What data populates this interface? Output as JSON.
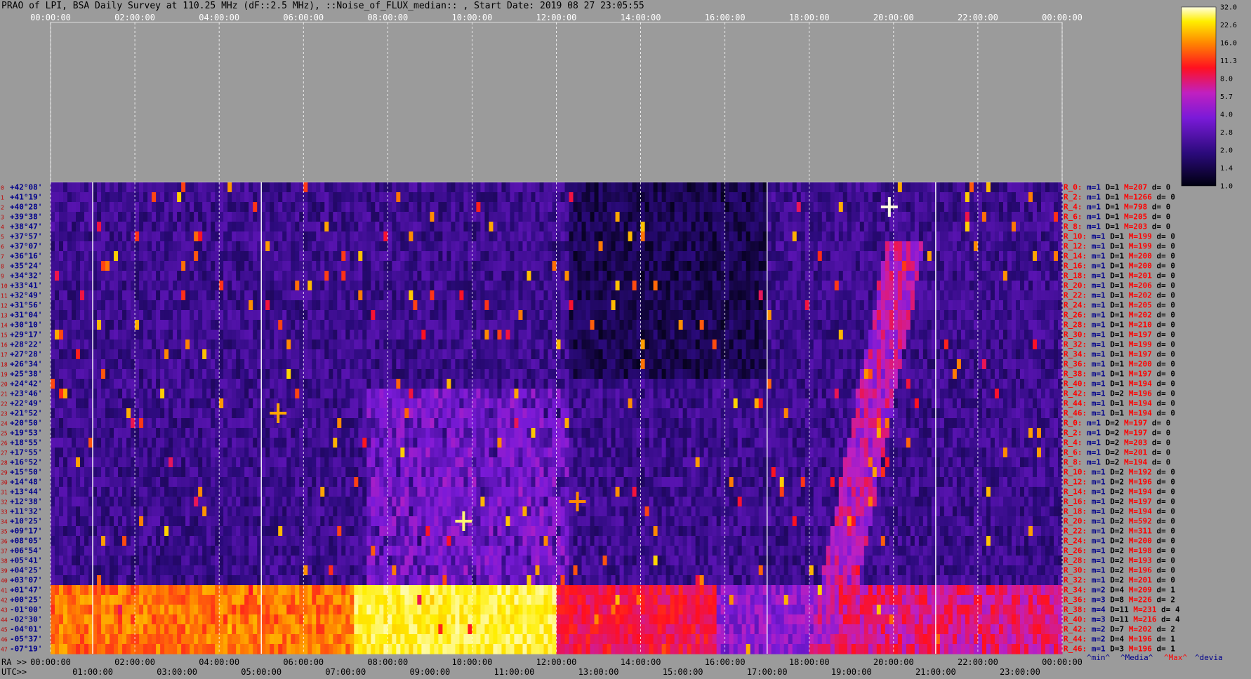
{
  "title": "PRAO of LPI, BSA Daily Survey at 110.25 MHz (dF::2.5 MHz), ::Noise_of_FLUX_median:: , Start Date: 2019 08 27 23:05:55",
  "colors": {
    "background": "#9b9b9b",
    "red_text": "#ff0000",
    "blue_text": "#00008b"
  },
  "axis": {
    "ra_label": "RA >>",
    "utc_label": "UTC>>",
    "top_ticks": [
      "00:00:00",
      "02:00:00",
      "04:00:00",
      "06:00:00",
      "08:00:00",
      "10:00:00",
      "12:00:00",
      "14:00:00",
      "16:00:00",
      "18:00:00",
      "20:00:00",
      "22:00:00",
      "00:00:00"
    ],
    "bottom_ra_ticks": [
      "00:00:00",
      "02:00:00",
      "04:00:00",
      "06:00:00",
      "08:00:00",
      "10:00:00",
      "12:00:00",
      "14:00:00",
      "16:00:00",
      "18:00:00",
      "20:00:00",
      "22:00:00",
      "00:00:00"
    ],
    "bottom_utc_ticks": [
      "01:00:00",
      "03:00:00",
      "05:00:00",
      "07:00:00",
      "09:00:00",
      "11:00:00",
      "13:00:00",
      "15:00:00",
      "17:00:00",
      "19:00:00",
      "21:00:00",
      "23:00:00"
    ]
  },
  "colorbar": {
    "labels": [
      "32.0",
      "22.6",
      "16.0",
      "11.3",
      "8.0",
      "5.7",
      "4.0",
      "2.8",
      "2.0",
      "1.4",
      "1.0"
    ]
  },
  "footer_legend": {
    "min": "^min^",
    "media": "^Media^",
    "max": "^Max^",
    "devia": "^devia"
  },
  "chart_data": {
    "type": "heatmap",
    "title": "PRAO of LPI, BSA Daily Survey at 110.25 MHz (dF::2.5 MHz), ::Noise_of_FLUX_median:: , Start Date: 2019 08 27 23:05:55",
    "xlabel": "RA / UTC",
    "x_range": [
      "00:00:00",
      "24:00:00"
    ],
    "colorbar_range": [
      1.0,
      32.0
    ],
    "declinations": [
      "+42°08'",
      "+41°19'",
      "+40°28'",
      "+39°38'",
      "+38°47'",
      "+37°57'",
      "+37°07'",
      "+36°16'",
      "+35°24'",
      "+34°32'",
      "+33°41'",
      "+32°49'",
      "+31°56'",
      "+31°04'",
      "+30°10'",
      "+29°17'",
      "+28°22'",
      "+27°28'",
      "+26°34'",
      "+25°38'",
      "+24°42'",
      "+23°46'",
      "+22°49'",
      "+21°52'",
      "+20°50'",
      "+19°53'",
      "+18°55'",
      "+17°55'",
      "+16°52'",
      "+15°50'",
      "+14°48'",
      "+13°44'",
      "+12°38'",
      "+11°32'",
      "+10°25'",
      "+09°17'",
      "+08°05'",
      "+06°54'",
      "+05°41'",
      "+04°25'",
      "+03°07'",
      "+01°47'",
      "+00°25'",
      "-01°00'",
      "-02°30'",
      "-04°01'",
      "-05°37'",
      "-07°19'"
    ],
    "row_stats": [
      {
        "r": "R_0:",
        "m": "m=1",
        "D": "D=1",
        "M": "M=207",
        "d": "d= 0"
      },
      {
        "r": "R_2:",
        "m": "m=1",
        "D": "D=1",
        "M": "M=1266",
        "d": "d= 0"
      },
      {
        "r": "R_4:",
        "m": "m=1",
        "D": "D=1",
        "M": "M=798",
        "d": "d= 0"
      },
      {
        "r": "R_6:",
        "m": "m=1",
        "D": "D=1",
        "M": "M=205",
        "d": "d= 0"
      },
      {
        "r": "R_8:",
        "m": "m=1",
        "D": "D=1",
        "M": "M=203",
        "d": "d= 0"
      },
      {
        "r": "R_10:",
        "m": "m=1",
        "D": "D=1",
        "M": "M=199",
        "d": "d= 0"
      },
      {
        "r": "R_12:",
        "m": "m=1",
        "D": "D=1",
        "M": "M=199",
        "d": "d= 0"
      },
      {
        "r": "R_14:",
        "m": "m=1",
        "D": "D=1",
        "M": "M=200",
        "d": "d= 0"
      },
      {
        "r": "R_16:",
        "m": "m=1",
        "D": "D=1",
        "M": "M=200",
        "d": "d= 0"
      },
      {
        "r": "R_18:",
        "m": "m=1",
        "D": "D=1",
        "M": "M=201",
        "d": "d= 0"
      },
      {
        "r": "R_20:",
        "m": "m=1",
        "D": "D=1",
        "M": "M=206",
        "d": "d= 0"
      },
      {
        "r": "R_22:",
        "m": "m=1",
        "D": "D=1",
        "M": "M=202",
        "d": "d= 0"
      },
      {
        "r": "R_24:",
        "m": "m=1",
        "D": "D=1",
        "M": "M=205",
        "d": "d= 0"
      },
      {
        "r": "R_26:",
        "m": "m=1",
        "D": "D=1",
        "M": "M=202",
        "d": "d= 0"
      },
      {
        "r": "R_28:",
        "m": "m=1",
        "D": "D=1",
        "M": "M=210",
        "d": "d= 0"
      },
      {
        "r": "R_30:",
        "m": "m=1",
        "D": "D=1",
        "M": "M=197",
        "d": "d= 0"
      },
      {
        "r": "R_32:",
        "m": "m=1",
        "D": "D=1",
        "M": "M=199",
        "d": "d= 0"
      },
      {
        "r": "R_34:",
        "m": "m=1",
        "D": "D=1",
        "M": "M=197",
        "d": "d= 0"
      },
      {
        "r": "R_36:",
        "m": "m=1",
        "D": "D=1",
        "M": "M=200",
        "d": "d= 0"
      },
      {
        "r": "R_38:",
        "m": "m=1",
        "D": "D=1",
        "M": "M=197",
        "d": "d= 0"
      },
      {
        "r": "R_40:",
        "m": "m=1",
        "D": "D=1",
        "M": "M=194",
        "d": "d= 0"
      },
      {
        "r": "R_42:",
        "m": "m=1",
        "D": "D=2",
        "M": "M=196",
        "d": "d= 0"
      },
      {
        "r": "R_44:",
        "m": "m=1",
        "D": "D=1",
        "M": "M=194",
        "d": "d= 0"
      },
      {
        "r": "R_46:",
        "m": "m=1",
        "D": "D=1",
        "M": "M=194",
        "d": "d= 0"
      },
      {
        "r": "R_0:",
        "m": "m=1",
        "D": "D=2",
        "M": "M=197",
        "d": "d= 0"
      },
      {
        "r": "R_2:",
        "m": "m=1",
        "D": "D=2",
        "M": "M=197",
        "d": "d= 0"
      },
      {
        "r": "R_4:",
        "m": "m=1",
        "D": "D=2",
        "M": "M=203",
        "d": "d= 0"
      },
      {
        "r": "R_6:",
        "m": "m=1",
        "D": "D=2",
        "M": "M=201",
        "d": "d= 0"
      },
      {
        "r": "R_8:",
        "m": "m=1",
        "D": "D=2",
        "M": "M=194",
        "d": "d= 0"
      },
      {
        "r": "R_10:",
        "m": "m=1",
        "D": "D=2",
        "M": "M=192",
        "d": "d= 0"
      },
      {
        "r": "R_12:",
        "m": "m=1",
        "D": "D=2",
        "M": "M=196",
        "d": "d= 0"
      },
      {
        "r": "R_14:",
        "m": "m=1",
        "D": "D=2",
        "M": "M=194",
        "d": "d= 0"
      },
      {
        "r": "R_16:",
        "m": "m=1",
        "D": "D=2",
        "M": "M=197",
        "d": "d= 0"
      },
      {
        "r": "R_18:",
        "m": "m=1",
        "D": "D=2",
        "M": "M=194",
        "d": "d= 0"
      },
      {
        "r": "R_20:",
        "m": "m=1",
        "D": "D=2",
        "M": "M=592",
        "d": "d= 0"
      },
      {
        "r": "R_22:",
        "m": "m=1",
        "D": "D=2",
        "M": "M=311",
        "d": "d= 0"
      },
      {
        "r": "R_24:",
        "m": "m=1",
        "D": "D=2",
        "M": "M=200",
        "d": "d= 0"
      },
      {
        "r": "R_26:",
        "m": "m=1",
        "D": "D=2",
        "M": "M=198",
        "d": "d= 0"
      },
      {
        "r": "R_28:",
        "m": "m=1",
        "D": "D=2",
        "M": "M=193",
        "d": "d= 0"
      },
      {
        "r": "R_30:",
        "m": "m=1",
        "D": "D=2",
        "M": "M=196",
        "d": "d= 0"
      },
      {
        "r": "R_32:",
        "m": "m=1",
        "D": "D=2",
        "M": "M=201",
        "d": "d= 0"
      },
      {
        "r": "R_34:",
        "m": "m=2",
        "D": "D=4",
        "M": "M=209",
        "d": "d= 1"
      },
      {
        "r": "R_36:",
        "m": "m=3",
        "D": "D=8",
        "M": "M=226",
        "d": "d= 2"
      },
      {
        "r": "R_38:",
        "m": "m=4",
        "D": "D=11",
        "M": "M=231",
        "d": "d= 4"
      },
      {
        "r": "R_40:",
        "m": "m=3",
        "D": "D=11",
        "M": "M=216",
        "d": "d= 4"
      },
      {
        "r": "R_42:",
        "m": "m=2",
        "D": "D=7",
        "M": "M=202",
        "d": "d= 2"
      },
      {
        "r": "R_44:",
        "m": "m=2",
        "D": "D=4",
        "M": "M=196",
        "d": "d= 1"
      },
      {
        "r": "R_46:",
        "m": "m=1",
        "D": "D=3",
        "M": "M=196",
        "d": "d= 1"
      }
    ],
    "bright_sources": [
      {
        "ra_h": 19.9,
        "dec_row": 2,
        "level": 32
      },
      {
        "ra_h": 9.8,
        "dec_row": 34,
        "level": 28
      },
      {
        "ra_h": 5.4,
        "dec_row": 23,
        "level": 18
      },
      {
        "ra_h": 12.5,
        "dec_row": 32,
        "level": 16
      }
    ]
  }
}
